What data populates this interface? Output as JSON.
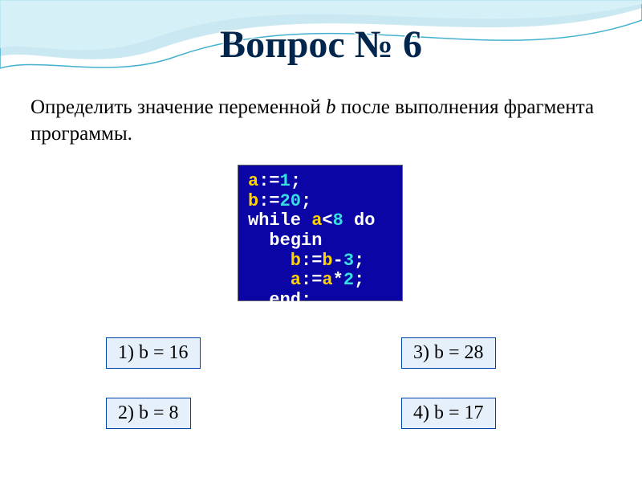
{
  "title": "Вопрос № 6",
  "prompt_pre": "Определить значение переменной ",
  "prompt_var": "b",
  "prompt_post": " после выполнения фрагмента программы.",
  "code": {
    "l1_a": "a",
    "l1_b": ":=",
    "l1_c": "1",
    "l1_d": ";",
    "l2_a": "b",
    "l2_b": ":=",
    "l2_c": "20",
    "l2_d": ";",
    "l3_a": "while ",
    "l3_b": "a",
    "l3_c": "<",
    "l3_d": "8",
    "l3_e": " do",
    "l4": "  begin",
    "l5_a": "    b",
    "l5_b": ":=",
    "l5_c": "b",
    "l5_d": "-",
    "l5_e": "3",
    "l5_f": ";",
    "l6_a": "    a",
    "l6_b": ":=",
    "l6_c": "a",
    "l6_d": "*",
    "l6_e": "2",
    "l6_f": ";",
    "l7_a": "  end",
    "l7_b": ";"
  },
  "options": {
    "o1": "1) b = 16",
    "o2": "2) b = 8",
    "o3": "3) b = 28",
    "o4": "4) b = 17"
  }
}
